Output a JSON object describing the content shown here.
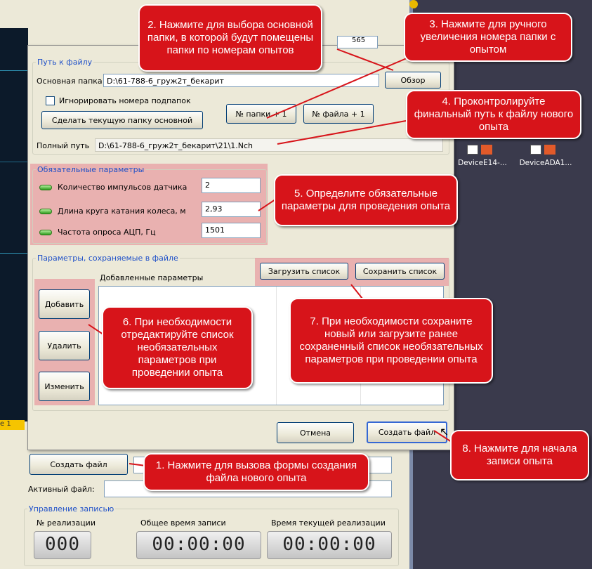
{
  "desktop": {
    "icons": [
      {
        "label": "DeviceE14-...",
        "icon": "device-e14-icon"
      },
      {
        "label": "DeviceADA1...",
        "icon": "device-ada1-icon"
      }
    ]
  },
  "background": {
    "tag_565": "565",
    "tag_e1": "e 1",
    "create_file_label": "Создать файл",
    "active_file_label": "Активный файл:",
    "record_legend": "Управление записью",
    "realization_label": "№ реализации",
    "total_time_label": "Общее время записи",
    "current_time_label": "Время текущей реализации",
    "realization_value": "000",
    "total_time_value": "00:00:00",
    "current_time_value": "00:00:00"
  },
  "dialog": {
    "path_legend": "Путь к файлу",
    "base_folder_label": "Основная папка",
    "base_folder_value": "D:\\61-788-6_груж2т_бекарит",
    "browse_label": "Обзор",
    "ignore_label": "Игнорировать номера подпапок",
    "make_current_label": "Сделать текущую папку основной",
    "folder_plus_label": "№ папки + 1",
    "file_plus_label": "№ файла + 1",
    "full_path_label": "Полный путь",
    "full_path_value": "D:\\61-788-6_груж2т_бекарит\\21\\1.Nch",
    "required_legend": "Обязательные параметры",
    "required": [
      {
        "label": "Количество импульсов датчика",
        "value": "2"
      },
      {
        "label": "Длина круга катания колеса, м",
        "value": "2,93"
      },
      {
        "label": "Частота опроса АЦП, Гц",
        "value": "1501"
      }
    ],
    "saved_legend": "Параметры, сохраняемые в файле",
    "added_params_label": "Добавленные параметры",
    "load_list_label": "Загрузить список",
    "save_list_label": "Сохранить список",
    "add_label": "Добавить",
    "delete_label": "Удалить",
    "edit_label": "Изменить",
    "cancel_label": "Отмена",
    "create_label": "Создать файл"
  },
  "callouts": {
    "c1": "1. Нажмите для вызова формы создания файла нового опыта",
    "c2": "2. Нажмите для выбора основной папки, в которой будут помещены папки по номерам опытов",
    "c3": "3. Нажмите для ручного увеличения номера папки с опытом",
    "c4": "4. Проконтролируйте финальный путь к файлу нового опыта",
    "c5": "5. Определите обязательные параметры для проведения опыта",
    "c6": "6. При необходимости отредактируйте список необязательных параметров при проведении опыта",
    "c7": "7. При необходимости сохраните новый или загрузите ранее сохраненный список необязательных параметров при проведении опыта",
    "c8": "8. Нажмите для начала записи опыта"
  },
  "colors": {
    "callout_red": "#d7141a",
    "highlight_pink": "#e88c96",
    "legend_blue": "#1f50c8",
    "desktop": "#3a3a4c"
  }
}
